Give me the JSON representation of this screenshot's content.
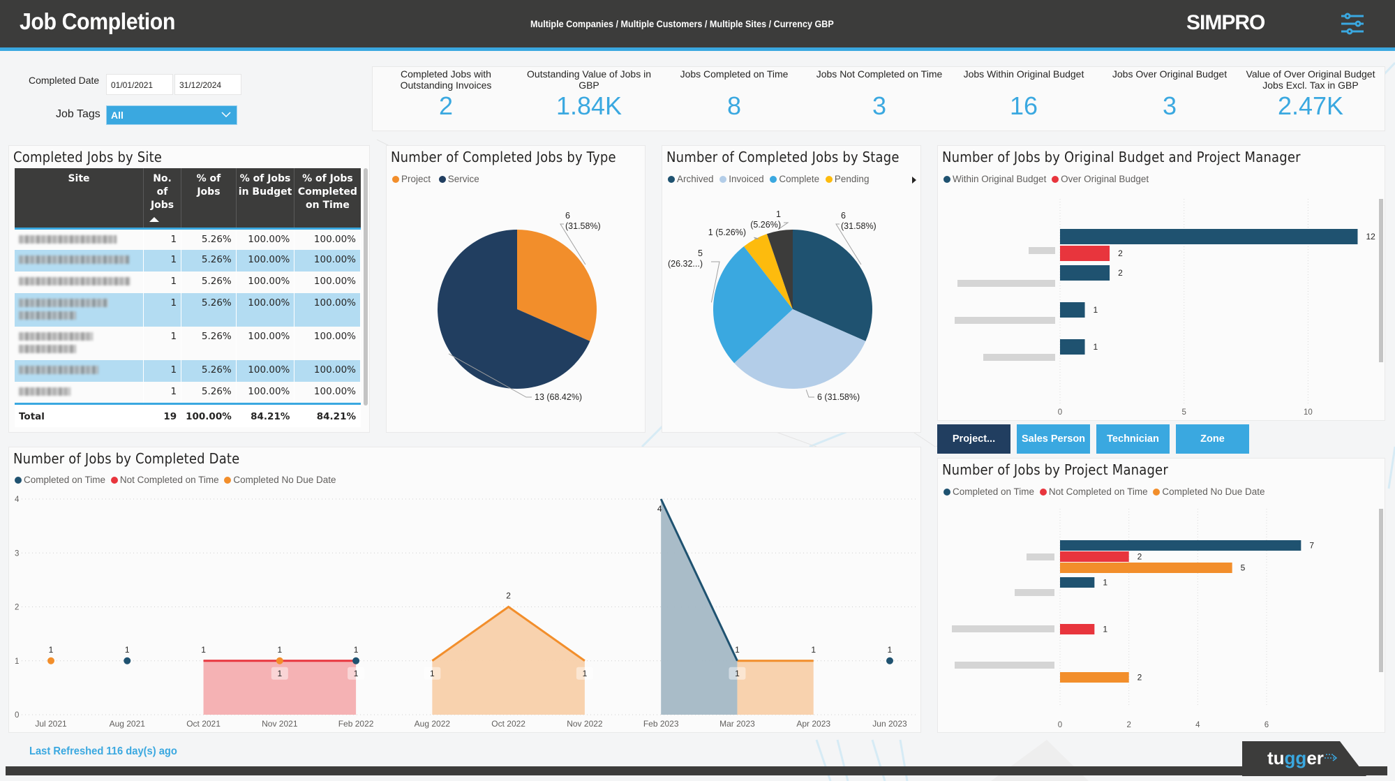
{
  "header": {
    "title": "Job Completion",
    "breadcrumb": "Multiple Companies / Multiple Customers / Multiple Sites / Currency GBP",
    "logo": "SIMPRO",
    "settings_icon": "sliders-icon"
  },
  "filters": {
    "completed_date_label": "Completed Date",
    "date_from": "01/01/2021",
    "date_to": "31/12/2024",
    "job_tags_label": "Job Tags",
    "job_tags_value": "All"
  },
  "kpis": [
    {
      "label": "Completed Jobs with Outstanding Invoices",
      "value": "2"
    },
    {
      "label": "Outstanding Value of Jobs in GBP",
      "value": "1.84K"
    },
    {
      "label": "Jobs Completed on Time",
      "value": "8"
    },
    {
      "label": "Jobs Not Completed on Time",
      "value": "3"
    },
    {
      "label": "Jobs Within Original Budget",
      "value": "16"
    },
    {
      "label": "Jobs Over Original Budget",
      "value": "3"
    },
    {
      "label": "Value of Over Original Budget Jobs Excl. Tax in GBP",
      "value": "2.47K"
    }
  ],
  "colors": {
    "accent": "#3aa8e0",
    "dark": "#3c3c3b",
    "navy": "#213e60",
    "teal_navy": "#1f5270",
    "orange": "#f28e2b",
    "red": "#e8353d",
    "light_blue": "#b3cde8",
    "yellow": "#fdbb0d",
    "gray_dark": "#3c3c3b"
  },
  "site_table": {
    "title": "Completed Jobs by Site",
    "columns": [
      "Site",
      "No. of Jobs",
      "% of Jobs",
      "% of Jobs in Budget",
      "% of Jobs Completed on Time"
    ],
    "rows": [
      {
        "site": "[redacted]",
        "jobs": "1",
        "pct_jobs": "5.26%",
        "pct_budget": "100.00%",
        "pct_on_time": "100.00%"
      },
      {
        "site": "[redacted]",
        "jobs": "1",
        "pct_jobs": "5.26%",
        "pct_budget": "100.00%",
        "pct_on_time": "100.00%"
      },
      {
        "site": "[redacted]",
        "jobs": "1",
        "pct_jobs": "5.26%",
        "pct_budget": "100.00%",
        "pct_on_time": "100.00%"
      },
      {
        "site": "[redacted]",
        "jobs": "1",
        "pct_jobs": "5.26%",
        "pct_budget": "100.00%",
        "pct_on_time": "100.00%"
      },
      {
        "site": "[redacted]",
        "jobs": "1",
        "pct_jobs": "5.26%",
        "pct_budget": "100.00%",
        "pct_on_time": "100.00%"
      },
      {
        "site": "[redacted]",
        "jobs": "1",
        "pct_jobs": "5.26%",
        "pct_budget": "100.00%",
        "pct_on_time": "100.00%"
      },
      {
        "site": "[redacted]",
        "jobs": "1",
        "pct_jobs": "5.26%",
        "pct_budget": "100.00%",
        "pct_on_time": "100.00%"
      }
    ],
    "total": {
      "label": "Total",
      "jobs": "19",
      "pct_jobs": "100.00%",
      "pct_budget": "84.21%",
      "pct_on_time": "84.21%"
    }
  },
  "group_buttons": [
    {
      "label": "Project...",
      "active": true
    },
    {
      "label": "Sales Person",
      "active": false
    },
    {
      "label": "Technician",
      "active": false
    },
    {
      "label": "Zone",
      "active": false
    }
  ],
  "footer": {
    "last_refreshed": "Last Refreshed 116 day(s) ago",
    "brand": "tugger"
  },
  "chart_data": [
    {
      "id": "by_type",
      "type": "pie",
      "title": "Number of Completed Jobs by Type",
      "legend": "top-left",
      "slices": [
        {
          "name": "Project",
          "value": 6,
          "pct": "31.58%",
          "color": "#f28e2b",
          "label": "6 (31.58%)"
        },
        {
          "name": "Service",
          "value": 13,
          "pct": "68.42%",
          "color": "#213e60",
          "label": "13 (68.42%)"
        }
      ]
    },
    {
      "id": "by_stage",
      "type": "pie",
      "title": "Number of Completed Jobs by Stage",
      "legend": "top-left",
      "slices": [
        {
          "name": "Archived",
          "value": 6,
          "pct": "31.58%",
          "color": "#1f5270",
          "label": "6 (31.58%)"
        },
        {
          "name": "Invoiced",
          "value": 6,
          "pct": "31.58%",
          "color": "#b3cde8",
          "label": "6 (31.58%)"
        },
        {
          "name": "Complete",
          "value": 5,
          "pct": "26.32%",
          "color": "#3aa8e0",
          "label": "5 (26.32...)"
        },
        {
          "name": "Pending",
          "value": 1,
          "pct": "5.26%",
          "color": "#fdbb0d",
          "label": "1 (5.26%)"
        },
        {
          "name": "",
          "value": 1,
          "pct": "5.26%",
          "color": "#3c3c3b",
          "label": "1 (5.26%)"
        }
      ]
    },
    {
      "id": "budget_by_pm",
      "type": "bar",
      "orientation": "horizontal",
      "title": "Number of Jobs by Original Budget and Project Manager",
      "legend": "top-left",
      "categories": [
        "[redacted]",
        "[redacted]",
        "[redacted]",
        "[redacted]"
      ],
      "series": [
        {
          "name": "Within Original Budget",
          "color": "#1f5270",
          "values": [
            12,
            2,
            1,
            1
          ]
        },
        {
          "name": "Over Original Budget",
          "color": "#e8353d",
          "values": [
            2,
            0,
            0,
            0
          ]
        }
      ],
      "xlim": [
        0,
        13
      ],
      "xticks": [
        "0",
        "5",
        "10"
      ],
      "grid": true
    },
    {
      "id": "by_completed_date",
      "type": "area",
      "title": "Number of Jobs by Completed Date",
      "legend": "top-left",
      "categories": [
        "Jul 2021",
        "Aug 2021",
        "Oct 2021",
        "Nov 2021",
        "Feb 2022",
        "Aug 2022",
        "Oct 2022",
        "Nov 2022",
        "Feb 2023",
        "Mar 2023",
        "Apr 2023",
        "Jun 2023"
      ],
      "series": [
        {
          "name": "Completed on Time",
          "color": "#1f5270",
          "values": [
            null,
            1,
            null,
            null,
            1,
            null,
            null,
            null,
            4,
            1,
            null,
            1
          ]
        },
        {
          "name": "Not Completed on Time",
          "color": "#e8353d",
          "values": [
            null,
            null,
            1,
            1,
            1,
            null,
            null,
            null,
            null,
            null,
            null,
            null
          ]
        },
        {
          "name": "Completed No Due Date",
          "color": "#f28e2b",
          "values": [
            1,
            null,
            null,
            1,
            null,
            1,
            2,
            1,
            null,
            1,
            1,
            null
          ]
        }
      ],
      "ylim": [
        0,
        4
      ],
      "yticks": [
        "0",
        "1",
        "2",
        "3",
        "4"
      ],
      "grid": true
    },
    {
      "id": "by_project_manager",
      "type": "bar",
      "orientation": "horizontal",
      "title": "Number of Jobs by Project Manager",
      "legend": "top-left",
      "categories": [
        "[redacted]",
        "[redacted]",
        "[redacted]",
        "[redacted]"
      ],
      "series": [
        {
          "name": "Completed on Time",
          "color": "#1f5270",
          "values": [
            7,
            1,
            0,
            0
          ]
        },
        {
          "name": "Not Completed on Time",
          "color": "#e8353d",
          "values": [
            2,
            0,
            1,
            0
          ]
        },
        {
          "name": "Completed No Due Date",
          "color": "#f28e2b",
          "values": [
            5,
            0,
            0,
            2
          ]
        }
      ],
      "xlim": [
        0,
        7.5
      ],
      "xticks": [
        "0",
        "2",
        "4",
        "6"
      ],
      "grid": true
    }
  ]
}
